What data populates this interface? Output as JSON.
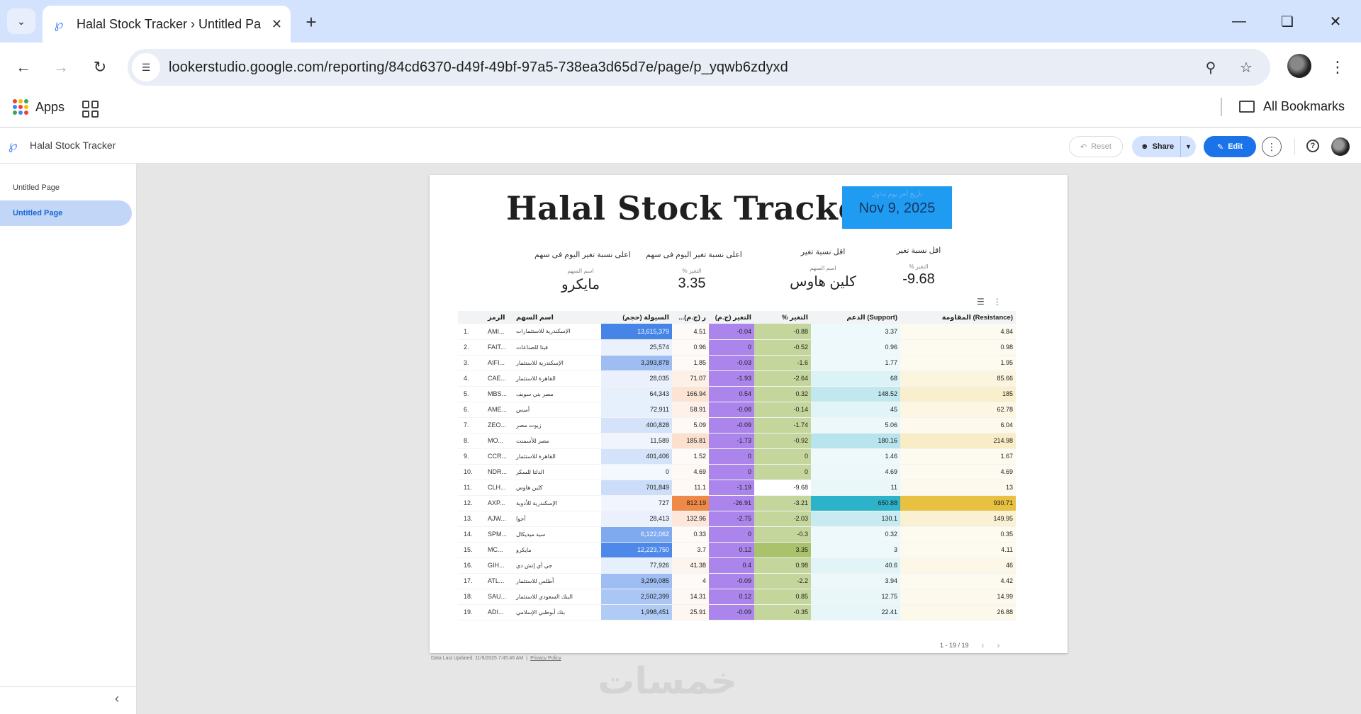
{
  "browser": {
    "tab_title": "Halal Stock Tracker › Untitled Page",
    "url": "lookerstudio.google.com/reporting/84cd6370-d49f-49bf-97a5-738ea3d65d7e/page/p_yqwb6zdyxd",
    "bookmarks": {
      "apps_label": "Apps",
      "all_bookmarks_label": "All Bookmarks"
    }
  },
  "looker": {
    "report_name": "Halal Stock Tracker",
    "buttons": {
      "reset": "Reset",
      "share": "Share",
      "edit": "Edit"
    },
    "pages": [
      {
        "label": "Untitled Page"
      },
      {
        "label": "Untitled Page"
      }
    ]
  },
  "report": {
    "title": "Halal Stock Tracker",
    "date_label": "تاريخ آخر يوم تداول",
    "date_value": "Nov 9, 2025",
    "kpis": [
      {
        "title": "اعلى نسبة تغير اليوم فى سهم",
        "label": "اسم السهم",
        "value": "مايكرو"
      },
      {
        "title": "اعلى نسبة تغير اليوم فى سهم",
        "label": "% التغير",
        "value": "3.35"
      },
      {
        "title": "اقل نسبة تغير",
        "label": "اسم السهم",
        "value": "كلين هاوس"
      },
      {
        "title": "اقل نسبة تغير",
        "label": "% التغير",
        "value": "-9.68"
      }
    ],
    "table": {
      "columns": [
        "",
        "الرمز",
        "اسم السهم",
        "السيولة (حجم)",
        "...ر (ج.م)",
        "التغير (ج.م)",
        "% التغير",
        "الدعم (Support)",
        "المقاومة (Resistance)"
      ],
      "rows": [
        [
          "1.",
          "AMI...",
          "الإسكندرية للاستثمارات",
          "13,615,379",
          "4.51",
          "-0.04",
          "-0.88",
          "3.37",
          "4.84"
        ],
        [
          "2.",
          "FAIT...",
          "فيتا للصناعات",
          "25,574",
          "0.96",
          "0",
          "-0.52",
          "0.96",
          "0.98"
        ],
        [
          "3.",
          "AIFI...",
          "الإسكندرية للاستثمار",
          "3,393,878",
          "1.85",
          "-0.03",
          "-1.6",
          "1.77",
          "1.95"
        ],
        [
          "4.",
          "CAE...",
          "القاهرة للاستثمار",
          "28,035",
          "71.07",
          "-1.93",
          "-2.64",
          "68",
          "85.66"
        ],
        [
          "5.",
          "MBS...",
          "مصر بني سويف",
          "64,343",
          "166.94",
          "0.54",
          "0.32",
          "148.52",
          "185"
        ],
        [
          "6.",
          "AME...",
          "أميس",
          "72,911",
          "58.91",
          "-0.08",
          "-0.14",
          "45",
          "62.78"
        ],
        [
          "7.",
          "ZEO...",
          "زيوت مصر",
          "400,828",
          "5.09",
          "-0.09",
          "-1.74",
          "5.06",
          "6.04"
        ],
        [
          "8.",
          "MO...",
          "مصر للأسمنت",
          "11,589",
          "185.81",
          "-1.73",
          "-0.92",
          "180.16",
          "214.98"
        ],
        [
          "9.",
          "CCR...",
          "القاهرة للاستثمار",
          "401,406",
          "1.52",
          "0",
          "0",
          "1.46",
          "1.67"
        ],
        [
          "10.",
          "NDR...",
          "الدلتا للسكر",
          "0",
          "4.69",
          "0",
          "0",
          "4.69",
          "4.69"
        ],
        [
          "11.",
          "CLH...",
          "كلين هاوس",
          "701,849",
          "11.1",
          "-1.19",
          "-9.68",
          "11",
          "13"
        ],
        [
          "12.",
          "AXP...",
          "الإسكندرية للأدوية",
          "727",
          "812.19",
          "-26.91",
          "-3.21",
          "650.88",
          "930.71"
        ],
        [
          "13.",
          "AJW...",
          "أجوا",
          "28,413",
          "132.96",
          "-2.75",
          "-2.03",
          "130.1",
          "149.95"
        ],
        [
          "14.",
          "SPM...",
          "سيد ميديكال",
          "6,122,062",
          "0.33",
          "0",
          "-0.3",
          "0.32",
          "0.35"
        ],
        [
          "15.",
          "MC...",
          "مايكرو",
          "12,223,750",
          "3.7",
          "0.12",
          "3.35",
          "3",
          "4.11"
        ],
        [
          "16.",
          "GIH...",
          "جي أي إتش دي",
          "77,926",
          "41.38",
          "0.4",
          "0.98",
          "40.6",
          "46"
        ],
        [
          "17.",
          "ATL...",
          "أطلس للاستثمار",
          "3,299,085",
          "4",
          "-0.09",
          "-2.2",
          "3.94",
          "4.42"
        ],
        [
          "18.",
          "SAU...",
          "البنك السعودي للاستثمار",
          "2,502,399",
          "14.31",
          "0.12",
          "0.85",
          "12.75",
          "14.99"
        ],
        [
          "19.",
          "ADI...",
          "بنك أبوظبي الإسلامي",
          "1,998,451",
          "25.91",
          "-0.09",
          "-0.35",
          "22.41",
          "26.88"
        ]
      ],
      "pager": "1 - 19 / 19"
    },
    "footer": {
      "updated": "Data Last Updated: 11/9/2025 7:45:46 AM",
      "privacy": "Privacy Policy"
    },
    "watermark": "خمسات"
  },
  "colors": {
    "accent": "#1a73e8",
    "date_box": "#1f9bf2",
    "change_col": "#ab85ec",
    "pct_col": "#c4d69b"
  }
}
